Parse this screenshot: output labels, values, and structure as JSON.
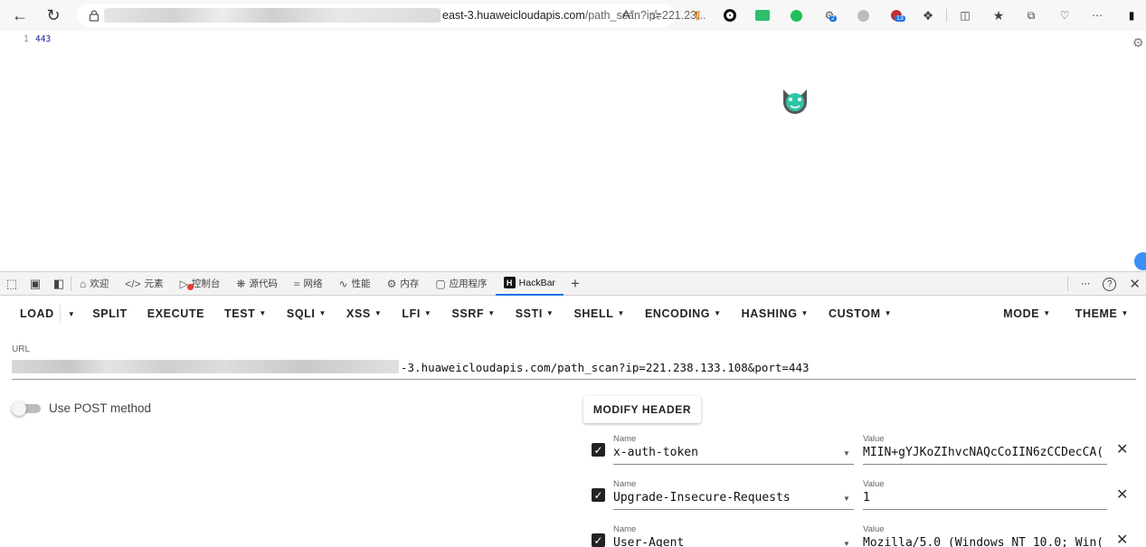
{
  "browser": {
    "url_visible": "east-3.huaweicloudapis.com",
    "url_path": "/path_scan?ip=221.23...",
    "extension_badges": [
      "2",
      "13"
    ]
  },
  "page": {
    "line_number": "1",
    "code_text": "443"
  },
  "devtools": {
    "tabs": [
      {
        "label": "欢迎",
        "icon": "home-icon"
      },
      {
        "label": "元素",
        "icon": "code-icon"
      },
      {
        "label": "控制台",
        "icon": "console-icon"
      },
      {
        "label": "源代码",
        "icon": "bug-icon"
      },
      {
        "label": "网络",
        "icon": "wifi-icon"
      },
      {
        "label": "性能",
        "icon": "performance-icon"
      },
      {
        "label": "内存",
        "icon": "memory-icon"
      },
      {
        "label": "应用程序",
        "icon": "application-icon"
      },
      {
        "label": "HackBar",
        "icon": "hackbar-logo-icon"
      }
    ],
    "active_tab": "HackBar"
  },
  "hackbar": {
    "menu": [
      "LOAD",
      "SPLIT",
      "EXECUTE",
      "TEST",
      "SQLI",
      "XSS",
      "LFI",
      "SSRF",
      "SSTI",
      "SHELL",
      "ENCODING",
      "HASHING",
      "CUSTOM"
    ],
    "menu_right": [
      "MODE",
      "THEME"
    ],
    "url_label": "URL",
    "url_value": "-3.huaweicloudapis.com/path_scan?ip=221.238.133.108&port=443",
    "post_label": "Use POST method",
    "post_enabled": false,
    "modify_header_label": "MODIFY HEADER",
    "name_label": "Name",
    "value_label": "Value",
    "headers": [
      {
        "name": "x-auth-token",
        "value": "MIIN+gYJKoZIhvcNAQcCoIIN6zCCDecCA(",
        "checked": true
      },
      {
        "name": "Upgrade-Insecure-Requests",
        "value": "1",
        "checked": true
      },
      {
        "name": "User-Agent",
        "value": "Mozilla/5.0 (Windows NT 10.0; Win(",
        "checked": true
      }
    ]
  }
}
